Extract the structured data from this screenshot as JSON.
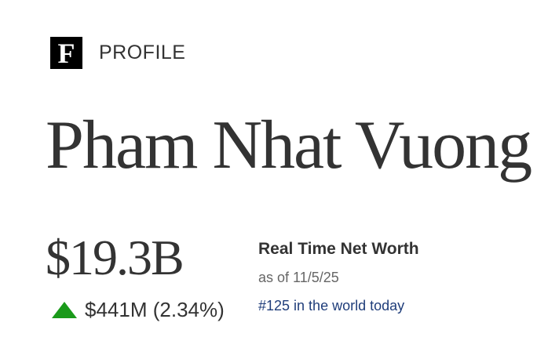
{
  "header": {
    "logo_letter": "F",
    "section": "PROFILE"
  },
  "profile": {
    "name": "Pham Nhat Vuong"
  },
  "net_worth": {
    "value": "$19.3B",
    "change": "$441M (2.34%)",
    "change_direction": "up",
    "change_color": "#1a9a1a",
    "label": "Real Time Net Worth",
    "as_of": "as of 11/5/25",
    "rank": "#125 in the world today",
    "rank_color": "#1f3d7a"
  }
}
